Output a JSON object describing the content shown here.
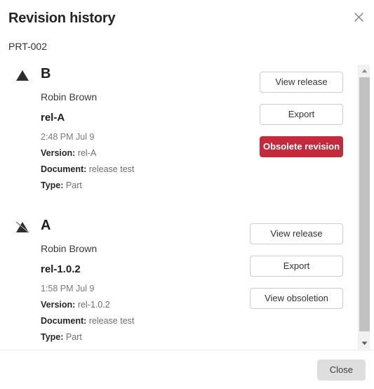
{
  "dialog": {
    "title": "Revision history",
    "subtitle": "PRT-002",
    "close_icon": "close-icon"
  },
  "revisions": [
    {
      "letter": "B",
      "status_icon": "current-revision-triangle-icon",
      "author": "Robin Brown",
      "release": "rel-A",
      "timestamp": "2:48 PM Jul 9",
      "meta": [
        {
          "label": "Version:",
          "value": "rel-A"
        },
        {
          "label": "Document:",
          "value": "release test"
        },
        {
          "label": "Type:",
          "value": "Part"
        }
      ],
      "actions": [
        {
          "label": "View release",
          "style": "default"
        },
        {
          "label": "Export",
          "style": "default"
        },
        {
          "label": "Obsolete revision",
          "style": "danger"
        }
      ]
    },
    {
      "letter": "A",
      "status_icon": "obsolete-revision-triangle-strike-icon",
      "author": "Robin Brown",
      "release": "rel-1.0.2",
      "timestamp": "1:58 PM Jul 9",
      "meta": [
        {
          "label": "Version:",
          "value": "rel-1.0.2"
        },
        {
          "label": "Document:",
          "value": "release test"
        },
        {
          "label": "Type:",
          "value": "Part"
        }
      ],
      "actions": [
        {
          "label": "View release",
          "style": "default"
        },
        {
          "label": "Export",
          "style": "default"
        },
        {
          "label": "View obsoletion",
          "style": "default"
        }
      ]
    }
  ],
  "scrollbar": {
    "up_icon": "scroll-up-arrow-icon",
    "down_icon": "scroll-down-arrow-icon"
  },
  "footer": {
    "close_label": "Close"
  },
  "colors": {
    "danger": "#c32b3c",
    "button_border": "#cccccc",
    "scrollbar_thumb": "#c1c1c1",
    "footer_button": "#dedede"
  }
}
